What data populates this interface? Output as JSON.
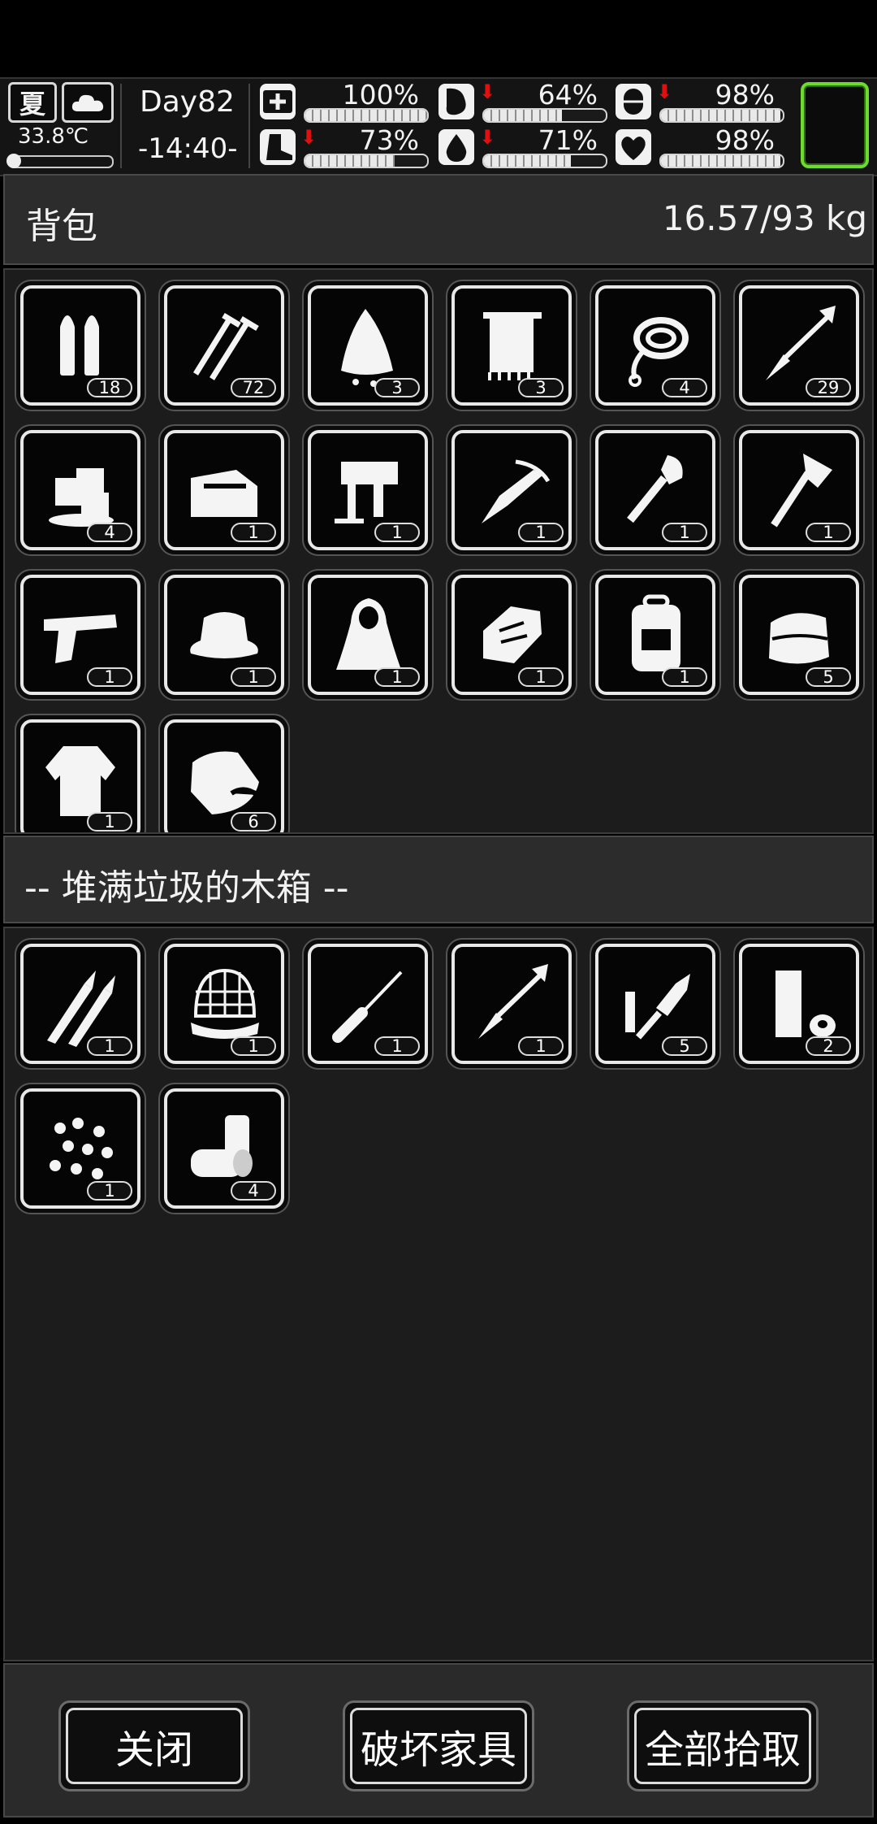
{
  "status": {
    "season": "夏",
    "weather_icon": "cloud-icon",
    "temperature": "33.8℃",
    "day": "Day82",
    "time": "-14:40-",
    "stats": [
      {
        "name": "health",
        "icon": "medkit-icon",
        "percent_text": "100%",
        "value": 100,
        "decreasing": false
      },
      {
        "name": "hunger",
        "icon": "stomach-icon",
        "percent_text": "64%",
        "value": 64,
        "decreasing": true
      },
      {
        "name": "mood",
        "icon": "pill-icon",
        "percent_text": "98%",
        "value": 98,
        "decreasing": true
      },
      {
        "name": "stamina",
        "icon": "boot-icon",
        "percent_text": "73%",
        "value": 73,
        "decreasing": true
      },
      {
        "name": "thirst",
        "icon": "water-drop-icon",
        "percent_text": "71%",
        "value": 71,
        "decreasing": true
      },
      {
        "name": "heart",
        "icon": "heart-icon",
        "percent_text": "98%",
        "value": 98,
        "decreasing": false
      }
    ]
  },
  "backpack": {
    "title": "背包",
    "weight": "16.57/93 kg",
    "items": [
      {
        "icon": "bullets-icon",
        "count": "18"
      },
      {
        "icon": "nails-icon",
        "count": "72"
      },
      {
        "icon": "cloth-rag-icon",
        "count": "3"
      },
      {
        "icon": "towel-icon",
        "count": "3"
      },
      {
        "icon": "rope-icon",
        "count": "4"
      },
      {
        "icon": "arrow-icon",
        "count": "29"
      },
      {
        "icon": "ice-cubes-icon",
        "count": "4"
      },
      {
        "icon": "toolbox-icon",
        "count": "1"
      },
      {
        "icon": "drill-icon",
        "count": "1"
      },
      {
        "icon": "crossbow-icon",
        "count": "1"
      },
      {
        "icon": "shovel-icon",
        "count": "1"
      },
      {
        "icon": "axe-icon",
        "count": "1"
      },
      {
        "icon": "pistol-icon",
        "count": "1"
      },
      {
        "icon": "hat-icon",
        "count": "1"
      },
      {
        "icon": "cloak-icon",
        "count": "1"
      },
      {
        "icon": "gloves-icon",
        "count": "1"
      },
      {
        "icon": "backpack-icon",
        "count": "1"
      },
      {
        "icon": "folded-cloth-icon",
        "count": "5"
      },
      {
        "icon": "jacket-icon",
        "count": "1"
      },
      {
        "icon": "food-bag-icon",
        "count": "6"
      }
    ]
  },
  "container": {
    "title": "-- 堆满垃圾的木箱 --",
    "items": [
      {
        "icon": "rifle-bullets-icon",
        "count": "1"
      },
      {
        "icon": "net-icon",
        "count": "1"
      },
      {
        "icon": "screwdriver-icon",
        "count": "1"
      },
      {
        "icon": "arrow-icon",
        "count": "1"
      },
      {
        "icon": "spark-plug-icon",
        "count": "5"
      },
      {
        "icon": "tape-icon",
        "count": "2"
      },
      {
        "icon": "beads-icon",
        "count": "1"
      },
      {
        "icon": "cans-icon",
        "count": "4"
      }
    ]
  },
  "buttons": {
    "close": "关闭",
    "destroy": "破坏家具",
    "take_all": "全部拾取"
  }
}
